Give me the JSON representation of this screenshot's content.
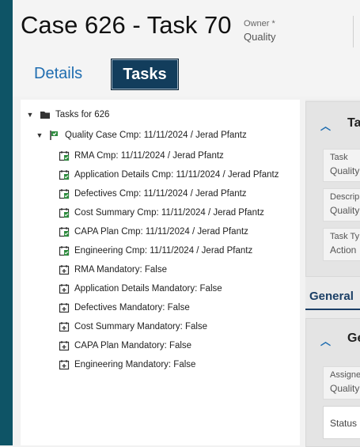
{
  "header": {
    "title": "Case 626 - Task 70",
    "owner_label": "Owner *",
    "owner_value": "Quality"
  },
  "tabs": {
    "details": "Details",
    "tasks": "Tasks"
  },
  "tree": {
    "root_label": "Tasks for 626",
    "quality_case_label": "Quality Case Cmp: 11/11/2024 / Jerad Pfantz",
    "completed_items": [
      "RMA Cmp: 11/11/2024 / Jerad Pfantz",
      "Application Details Cmp: 11/11/2024 / Jerad Pfantz",
      "Defectives Cmp: 11/11/2024 / Jerad Pfantz",
      "Cost Summary Cmp: 11/11/2024 / Jerad Pfantz",
      "CAPA Plan Cmp: 11/11/2024 / Jerad Pfantz",
      "Engineering Cmp: 11/11/2024 / Jerad Pfantz"
    ],
    "mandatory_items": [
      "RMA Mandatory: False",
      "Application Details Mandatory: False",
      "Defectives Mandatory: False",
      "Cost Summary Mandatory: False",
      "CAPA Plan Mandatory: False",
      "Engineering Mandatory: False"
    ]
  },
  "right_panel": {
    "task_card_title": "Ta",
    "fields": [
      {
        "label": "Task",
        "value": "Quality"
      },
      {
        "label": "Descrip",
        "value": "Quality"
      },
      {
        "label": "Task Ty",
        "value": "Action"
      }
    ],
    "general_tab": "General",
    "general_card_title": "Ge",
    "assigned_label": "Assigne",
    "assigned_value": "Quality",
    "status_label": "Status"
  },
  "colors": {
    "sidebar_teal": "#0e5466",
    "tab_active_bg": "#123d5c",
    "link_blue": "#1f6db0",
    "complete_green": "#2e8b3e"
  }
}
